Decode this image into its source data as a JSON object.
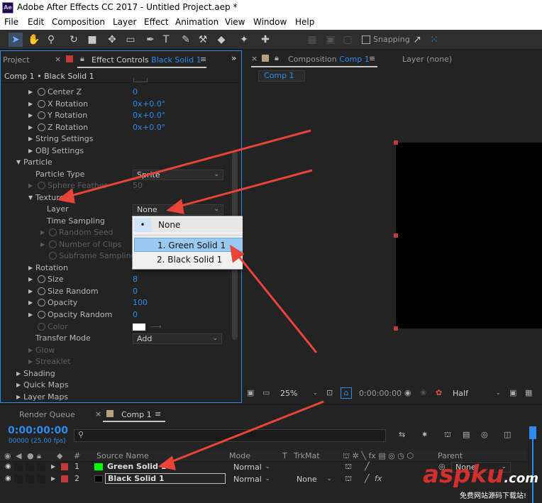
{
  "window": {
    "title": "Adobe After Effects CC 2017 - Untitled Project.aep *",
    "app_icon": "Ae"
  },
  "menu": [
    "File",
    "Edit",
    "Composition",
    "Layer",
    "Effect",
    "Animation",
    "View",
    "Window",
    "Help"
  ],
  "toolbar": {
    "snapping_label": "Snapping"
  },
  "left_panel": {
    "project_tab": "Project",
    "effect_controls_label": "Effect Controls",
    "effect_controls_target": "Black Solid 1",
    "breadcrumb": "Comp 1 • Black Solid 1"
  },
  "effect_rows": {
    "center_z": {
      "label": "Center Z",
      "value": "0"
    },
    "x_rotation": {
      "label": "X Rotation",
      "value_a": "0x",
      "value_b": "+0.0°"
    },
    "y_rotation": {
      "label": "Y Rotation",
      "value_a": "0x",
      "value_b": "+0.0°"
    },
    "z_rotation": {
      "label": "Z Rotation",
      "value_a": "0x",
      "value_b": "+0.0°"
    },
    "string_settings": {
      "label": "String Settings"
    },
    "obj_settings": {
      "label": "OBJ Settings"
    },
    "particle": {
      "label": "Particle"
    },
    "particle_type": {
      "label": "Particle Type",
      "value": "Sprite"
    },
    "sphere_feather": {
      "label": "Sphere Feather",
      "value": "50"
    },
    "texture": {
      "label": "Texture"
    },
    "layer": {
      "label": "Layer",
      "value": "None"
    },
    "time_sampling": {
      "label": "Time Sampling"
    },
    "random_seed": {
      "label": "Random Seed"
    },
    "number_of_clips": {
      "label": "Number of Clips"
    },
    "subframe_sampling": {
      "label": "Subframe Sampling"
    },
    "rotation": {
      "label": "Rotation"
    },
    "size": {
      "label": "Size",
      "value": "8"
    },
    "size_random": {
      "label": "Size Random",
      "value": "0"
    },
    "opacity": {
      "label": "Opacity",
      "value": "100"
    },
    "opacity_random": {
      "label": "Opacity Random",
      "value": "0"
    },
    "color": {
      "label": "Color",
      "swatch": "#ffffff"
    },
    "transfer_mode": {
      "label": "Transfer Mode",
      "value": "Add"
    },
    "glow": {
      "label": "Glow"
    },
    "streaklet": {
      "label": "Streaklet"
    },
    "shading": {
      "label": "Shading"
    },
    "quick_maps": {
      "label": "Quick Maps"
    },
    "layer_maps": {
      "label": "Layer Maps"
    }
  },
  "layer_dropdown": {
    "options": [
      "None",
      "1. Green Solid 1",
      "2. Black Solid 1"
    ],
    "selected": "None",
    "highlighted": "1. Green Solid 1"
  },
  "composition_panel": {
    "tab_label": "Composition",
    "comp_name": "Comp 1",
    "layer_panel": "Layer (none)",
    "comp_tab": "Comp 1"
  },
  "viewer_footer": {
    "zoom": "25%",
    "timecode": "0:00:00:00",
    "resolution": "Half"
  },
  "timeline": {
    "render_queue": "Render Queue",
    "comp_tab": "Comp 1",
    "timecode": "0:00:00:00",
    "fps": "00000 (25.00 fps)",
    "columns": {
      "num": "#",
      "source": "Source Name",
      "mode": "Mode",
      "t": "T",
      "trkmat": "TrkMat",
      "parent": "Parent"
    },
    "layers": [
      {
        "num": "1",
        "name": "Green Solid 1",
        "color": "#00ff00",
        "label_color": "#c23a3a",
        "mode": "Normal",
        "trkmat": "",
        "parent": "None"
      },
      {
        "num": "2",
        "name": "Black Solid 1",
        "color": "#000000",
        "label_color": "#c23a3a",
        "mode": "Normal",
        "trkmat": "None",
        "parent": ""
      }
    ]
  },
  "watermark": {
    "brand": "aspku",
    "tld": ".com",
    "tagline": "免费网站源码下载站!"
  },
  "colors": {
    "accent": "#2d8ceb",
    "arrow": "#e8443a"
  }
}
